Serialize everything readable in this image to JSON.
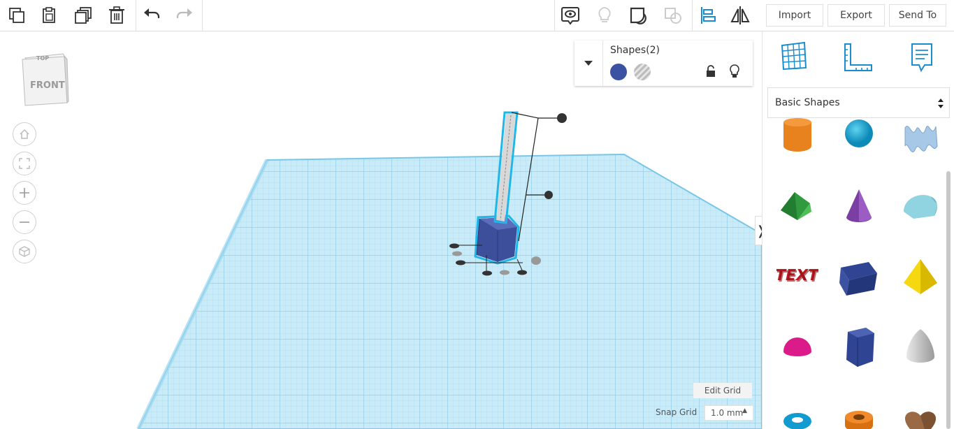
{
  "toolbar": {
    "actions": [
      "copy",
      "paste",
      "duplicate",
      "delete",
      "undo",
      "redo"
    ],
    "view_tools": [
      "show-hide",
      "light-toggle",
      "group",
      "ungroup",
      "align",
      "mirror"
    ]
  },
  "header_buttons": {
    "import": "Import",
    "export": "Export",
    "send_to": "Send To"
  },
  "viewcube": {
    "top": "TOP",
    "front": "FRONT"
  },
  "shapes_panel": {
    "title": "Shapes(2)",
    "solid_color": "#3b52a3",
    "hole_label": "hole"
  },
  "sidebar": {
    "category": "Basic Shapes",
    "collapse_glyph": "❭"
  },
  "grid": {
    "edit_grid": "Edit Grid",
    "snap_grid_label": "Snap Grid",
    "snap_grid_value": "1.0 mm"
  },
  "colors": {
    "accent": "#1a8dd0",
    "grid_fill": "#bfe6f5",
    "grid_line": "#7fc8e8",
    "selected_outline": "#20b7e8"
  }
}
